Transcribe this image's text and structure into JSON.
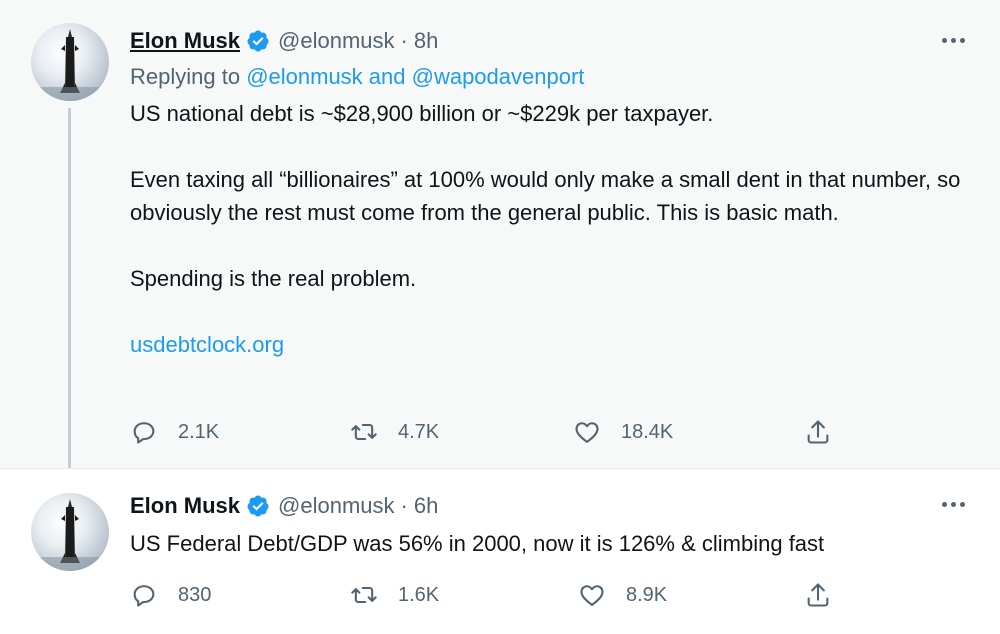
{
  "tweets": [
    {
      "author": "Elon Musk",
      "handle": "@elonmusk",
      "separator": "·",
      "time": "8h",
      "replying_prefix": "Replying to ",
      "replying_to": "@elonmusk and @wapodavenport",
      "paragraphs": [
        "US national debt is ~$28,900 billion or ~$229k per taxpayer.",
        "Even taxing all “billionaires” at 100% would only make a small dent in that number, so obviously the rest must come from the general public. This is basic math.",
        "Spending is the real problem."
      ],
      "link": "usdebtclock.org",
      "replies": "2.1K",
      "retweets": "4.7K",
      "likes": "18.4K"
    },
    {
      "author": "Elon Musk",
      "handle": "@elonmusk",
      "separator": "·",
      "time": "6h",
      "text": "US Federal Debt/GDP was 56% in 2000, now it is 126% & climbing fast",
      "replies": "830",
      "retweets": "1.6K",
      "likes": "8.9K"
    }
  ],
  "icons": {
    "verified": "verified-badge-icon",
    "reply": "reply-icon",
    "retweet": "retweet-icon",
    "like": "heart-icon",
    "share": "share-icon",
    "more": "more-icon"
  },
  "colors": {
    "link": "#1d9bf0",
    "muted": "#536471",
    "thread_line": "#c4cfd6",
    "highlight_bg": "#f7f9f9"
  }
}
